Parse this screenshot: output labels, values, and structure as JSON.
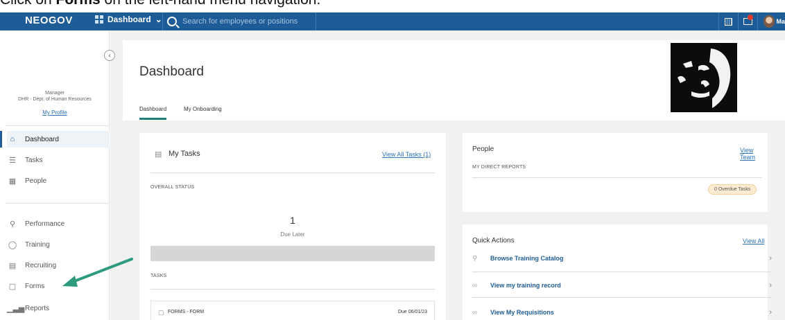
{
  "caption": {
    "prefix": "Click on ",
    "bold": "Forms",
    "suffix": " on the left-hand menu navigation."
  },
  "topbar": {
    "brand": "NEOGOV",
    "menu_label": "Dashboard",
    "search_placeholder": "Search for employees or positions",
    "avatar_text": "Ma",
    "colors": {
      "bar": "#1d5c96",
      "badge": "#e03a2f"
    }
  },
  "sidebar": {
    "role": "Manager",
    "dept": "DHR - Dept. of Human Resources",
    "profile_link": "My Profile",
    "nav_primary": [
      {
        "label": "Dashboard",
        "icon": "home-icon"
      },
      {
        "label": "Tasks",
        "icon": "tasks-icon"
      },
      {
        "label": "People",
        "icon": "people-icon"
      }
    ],
    "nav_secondary": [
      {
        "label": "Performance",
        "icon": "trophy-icon"
      },
      {
        "label": "Training",
        "icon": "bulb-icon"
      },
      {
        "label": "Recruiting",
        "icon": "clipboard-icon"
      },
      {
        "label": "Forms",
        "icon": "forms-icon"
      },
      {
        "label": "Reports",
        "icon": "bar-chart-icon"
      }
    ]
  },
  "header": {
    "title": "Dashboard",
    "tabs": [
      "Dashboard",
      "My Onboarding"
    ]
  },
  "my_tasks": {
    "title": "My Tasks",
    "view_all": "View All Tasks (1)",
    "overall_status": "OVERALL STATUS",
    "count": "1",
    "count_label": "Due Later",
    "tasks_heading": "TASKS",
    "task_name": "FORMS - FORM",
    "task_due": "Due 06/01/23"
  },
  "people": {
    "title": "People",
    "view_team": "View Team",
    "direct_reports": "MY DIRECT REPORTS",
    "overdue": "0 Overdue Tasks"
  },
  "quick_actions": {
    "title": "Quick Actions",
    "view_all": "View All",
    "items": [
      {
        "label": "Browse Training Catalog",
        "icon": "bulb-icon"
      },
      {
        "label": "View my training record",
        "icon": "link-icon"
      },
      {
        "label": "View My Requisitions",
        "icon": "link-icon"
      }
    ]
  },
  "annotation": {
    "arrow_color": "#2e9b7f"
  }
}
